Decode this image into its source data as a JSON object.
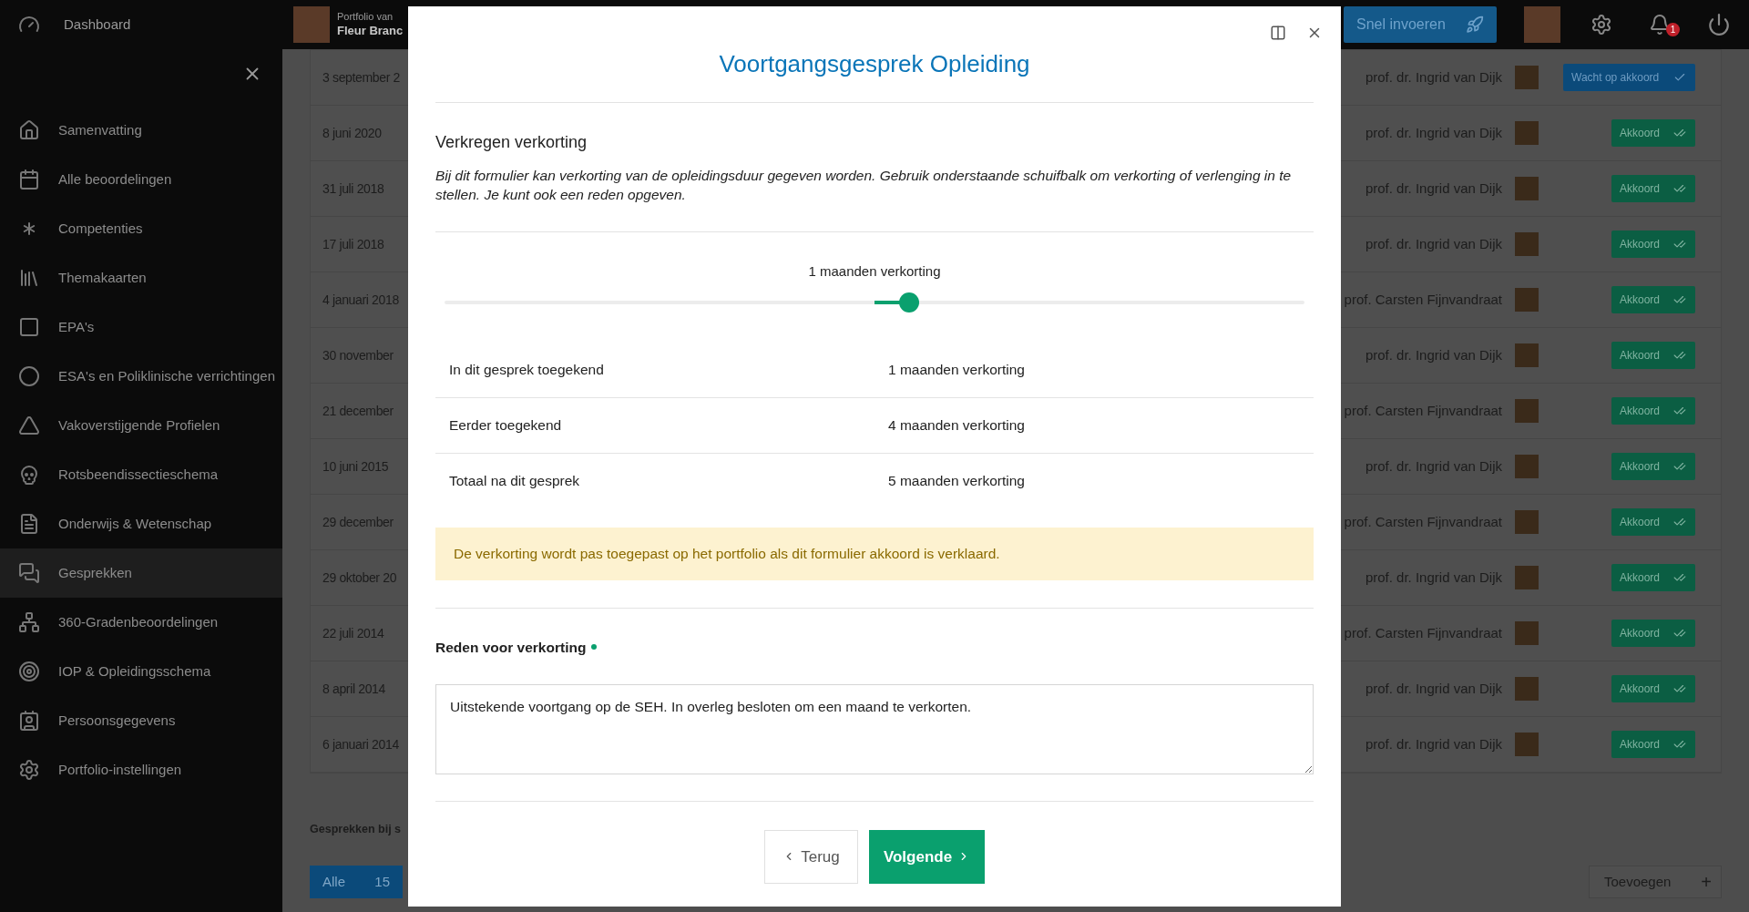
{
  "topbar": {
    "dashboard": "Dashboard",
    "portfolio_label": "Portfolio van",
    "portfolio_name": "Fleur Branc",
    "quick_entry": "Snel invoeren",
    "notification_count": "1"
  },
  "sidebar": {
    "items": [
      {
        "label": "Samenvatting",
        "selected": false
      },
      {
        "label": "Alle beoordelingen",
        "selected": false
      },
      {
        "label": "Competenties",
        "selected": false
      },
      {
        "label": "Themakaarten",
        "selected": false
      },
      {
        "label": "EPA's",
        "selected": false
      },
      {
        "label": "ESA's en Poliklinische verrichtingen",
        "selected": false
      },
      {
        "label": "Vakoverstijgende Profielen",
        "selected": false
      },
      {
        "label": "Rotsbeendissectieschema",
        "selected": false
      },
      {
        "label": "Onderwijs & Wetenschap",
        "selected": false
      },
      {
        "label": "Gesprekken",
        "selected": true
      },
      {
        "label": "360-Gradenbeoordelingen",
        "selected": false
      },
      {
        "label": "IOP & Opleidingsschema",
        "selected": false
      },
      {
        "label": "Persoonsgegevens",
        "selected": false
      },
      {
        "label": "Portfolio-instellingen",
        "selected": false
      }
    ]
  },
  "table": {
    "rows": [
      {
        "date": "3 september 2",
        "assessor": "prof. dr. Ingrid van Dijk",
        "status": {
          "kind": "waiting",
          "label": "Wacht op akkoord"
        }
      },
      {
        "date": "8 juni 2020",
        "assessor": "prof. dr. Ingrid van Dijk",
        "status": {
          "kind": "approved",
          "label": "Akkoord"
        }
      },
      {
        "date": "31 juli 2018",
        "assessor": "prof. dr. Ingrid van Dijk",
        "status": {
          "kind": "approved",
          "label": "Akkoord"
        }
      },
      {
        "date": "17 juli 2018",
        "assessor": "prof. dr. Ingrid van Dijk",
        "status": {
          "kind": "approved",
          "label": "Akkoord"
        }
      },
      {
        "date": "4 januari 2018",
        "assessor": "prof. Carsten Fijnvandraat",
        "status": {
          "kind": "approved",
          "label": "Akkoord"
        }
      },
      {
        "date": "30 november",
        "assessor": "prof. dr. Ingrid van Dijk",
        "status": {
          "kind": "approved",
          "label": "Akkoord"
        }
      },
      {
        "date": "21 december",
        "assessor": "prof. Carsten Fijnvandraat",
        "status": {
          "kind": "approved",
          "label": "Akkoord"
        }
      },
      {
        "date": "10 juni 2015",
        "assessor": "prof. dr. Ingrid van Dijk",
        "status": {
          "kind": "approved",
          "label": "Akkoord"
        }
      },
      {
        "date": "29 december",
        "assessor": "prof. Carsten Fijnvandraat",
        "status": {
          "kind": "approved",
          "label": "Akkoord"
        }
      },
      {
        "date": "29 oktober 20",
        "assessor": "prof. dr. Ingrid van Dijk",
        "status": {
          "kind": "approved",
          "label": "Akkoord"
        }
      },
      {
        "date": "22 juli 2014",
        "assessor": "prof. Carsten Fijnvandraat",
        "status": {
          "kind": "approved",
          "label": "Akkoord"
        }
      },
      {
        "date": "8 april 2014",
        "assessor": "prof. dr. Ingrid van Dijk",
        "status": {
          "kind": "approved",
          "label": "Akkoord"
        }
      },
      {
        "date": "6 januari 2014",
        "assessor": "prof. dr. Ingrid van Dijk",
        "status": {
          "kind": "approved",
          "label": "Akkoord"
        }
      }
    ]
  },
  "section_heading": "Gesprekken bij s",
  "filter_tabs": [
    {
      "label": "Alle",
      "count": "15",
      "selected": true
    }
  ],
  "add_button": {
    "label": "Toevoegen",
    "icon": "+"
  },
  "modal": {
    "title": "Voortgangsgesprek Opleiding",
    "section_title": "Verkregen verkorting",
    "description": "Bij dit formulier kan verkorting van de opleidingsduur gegeven worden. Gebruik onderstaande schuifbalk om verkorting of verlenging in te stellen. Je kunt ook een reden opgeven.",
    "slider": {
      "label": "1 maanden verkorting",
      "level": 0.54
    },
    "summary": [
      {
        "label": "In dit gesprek toegekend",
        "value": "1 maanden verkorting"
      },
      {
        "label": "Eerder toegekend",
        "value": "4 maanden verkorting"
      },
      {
        "label": "Totaal na dit gesprek",
        "value": "5 maanden verkorting"
      }
    ],
    "notice": "De verkorting wordt pas toegepast op het portfolio als dit formulier akkoord is verklaard.",
    "reason": {
      "label": "Reden voor verkorting",
      "required": true,
      "value": "Uitstekende voortgang op de SEH. In overleg besloten om een maand te verkorten."
    },
    "buttons": {
      "back": "Terug",
      "next": "Volgende"
    }
  }
}
